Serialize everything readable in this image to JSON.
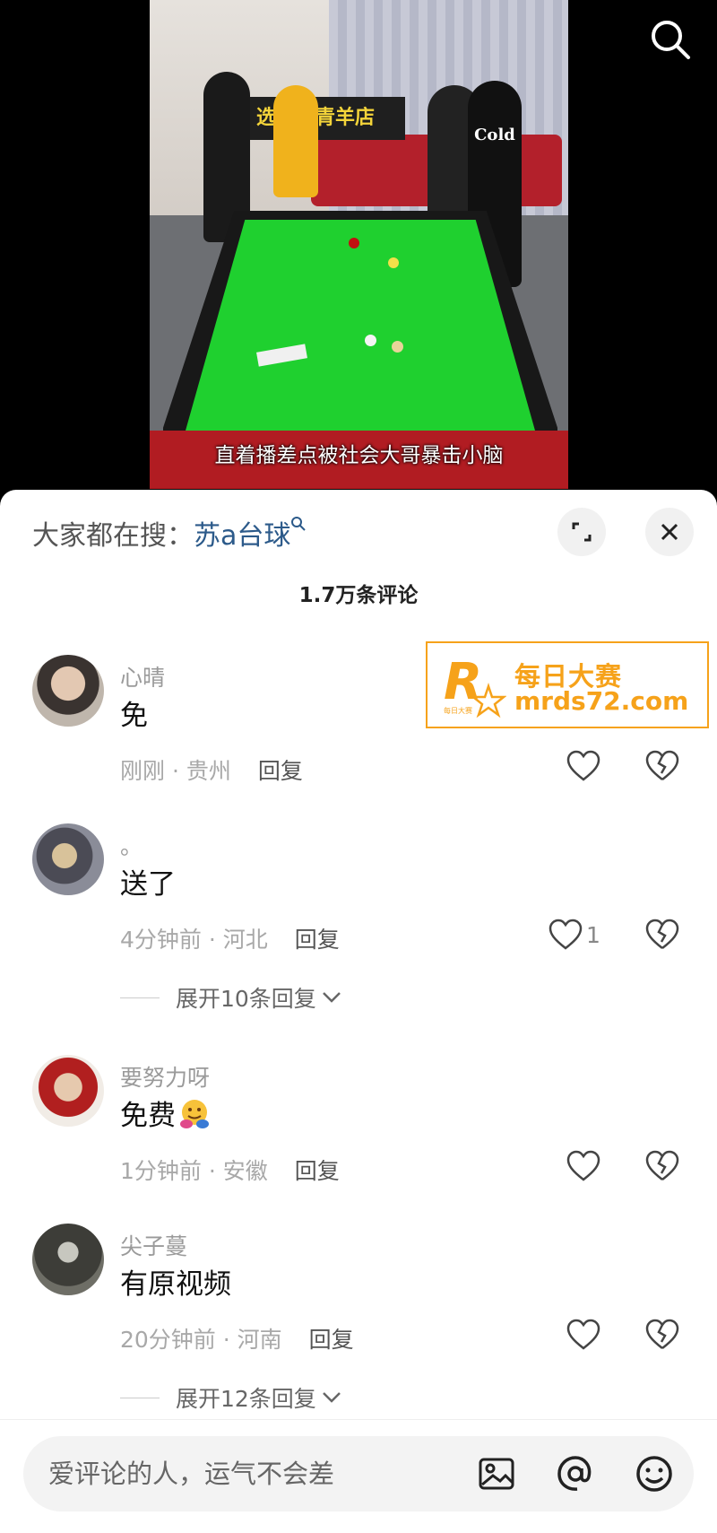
{
  "video": {
    "sign_text": "选台球青羊店",
    "caption": "直着播差点被社会大哥暴击小脑",
    "shirt_text": "Cold"
  },
  "sheet": {
    "hot_search_prefix": "大家都在搜：",
    "hot_search_keyword": "苏a台球",
    "comment_count": "1.7万条评论"
  },
  "comments": [
    {
      "nick": "心晴",
      "text": "免",
      "time_loc": "刚刚 · 贵州",
      "reply": "回复",
      "likes": ""
    },
    {
      "nick": "。",
      "text": "送了",
      "time_loc": "4分钟前 · 河北",
      "reply": "回复",
      "likes": "1",
      "expand": "展开10条回复"
    },
    {
      "nick": "要努力呀",
      "text": "免费",
      "time_loc": "1分钟前 · 安徽",
      "reply": "回复",
      "likes": ""
    },
    {
      "nick": "尖子蔓",
      "text": "有原视频",
      "time_loc": "20分钟前 · 河南",
      "reply": "回复",
      "likes": "",
      "expand": "展开12条回复"
    }
  ],
  "watermark": {
    "line1": "每日大赛",
    "line2": "mrds72.com",
    "logo_letter": "R",
    "logo_small": "每日大赛"
  },
  "input": {
    "placeholder": "爱评论的人，运气不会差"
  },
  "colors": {
    "accent": "#f6a21a",
    "keyword": "#2c5a8a",
    "felt": "#1fd02f"
  }
}
